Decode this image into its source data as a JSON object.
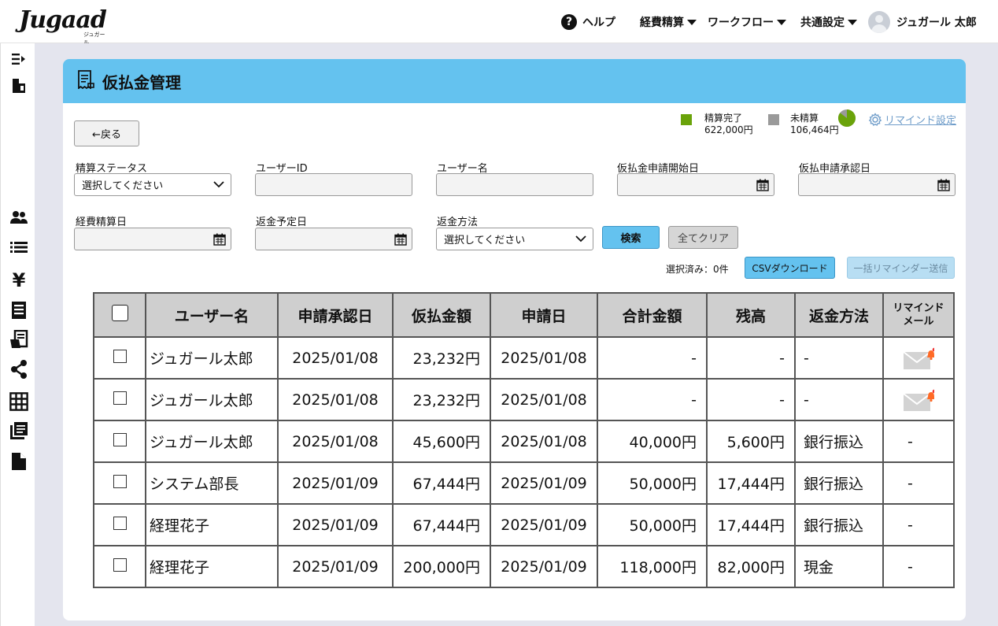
{
  "header": {
    "logo": "Jugaad",
    "logo_sub": "ジュガール",
    "help": "ヘルプ",
    "nav": [
      "経費精算",
      "ワークフロー",
      "共通設定"
    ],
    "user_name": "ジュガール 太郎"
  },
  "sidebar": {
    "icons": [
      "collapse-menu-icon",
      "building-icon",
      "users-icon",
      "list-icon",
      "yen-icon",
      "ledger-icon",
      "report-icon",
      "share-icon",
      "grid-icon",
      "books-icon",
      "document-icon"
    ]
  },
  "page": {
    "title": "仮払金管理",
    "back_label": "←戻る",
    "legend": {
      "done_label": "精算完了",
      "done_amount": "622,000円",
      "pending_label": "未精算",
      "pending_amount": "106,464円",
      "done_color": "#6aa30a",
      "pending_color": "#9a9a9a",
      "done_fraction": 0.854
    },
    "remind_settings": "リマインド設定"
  },
  "filters": {
    "status_label": "精算ステータス",
    "status_value": "選択してください",
    "user_id_label": "ユーザーID",
    "user_id_value": "",
    "user_name_label": "ユーザー名",
    "user_name_value": "",
    "apply_start_label": "仮払金申請開始日",
    "approve_date_label": "仮払申請承認日",
    "expense_date_label": "経費精算日",
    "refund_date_label": "返金予定日",
    "refund_method_label": "返金方法",
    "refund_method_value": "選択してください",
    "search_label": "検索",
    "clear_label": "全てクリア"
  },
  "actions": {
    "selected_count": "選択済み：0件",
    "csv_label": "CSVダウンロード",
    "bulk_label": "一括リマインダー送信"
  },
  "table": {
    "headers": [
      "ユーザー名",
      "申請承認日",
      "仮払金額",
      "申請日",
      "合計金額",
      "残高",
      "返金方法",
      "リマインド メール"
    ],
    "rows": [
      {
        "name": "ジュガール太郎",
        "approved": "2025/01/08",
        "advance": "23,232円",
        "applied": "2025/01/08",
        "total": "-",
        "balance": "-",
        "method": "-",
        "remind": "mail"
      },
      {
        "name": "ジュガール太郎",
        "approved": "2025/01/08",
        "advance": "23,232円",
        "applied": "2025/01/08",
        "total": "-",
        "balance": "-",
        "method": "-",
        "remind": "mail"
      },
      {
        "name": "ジュガール太郎",
        "approved": "2025/01/08",
        "advance": "45,600円",
        "applied": "2025/01/08",
        "total": "40,000円",
        "balance": "5,600円",
        "method": "銀行振込",
        "remind": "-"
      },
      {
        "name": "システム部長",
        "approved": "2025/01/09",
        "advance": "67,444円",
        "applied": "2025/01/09",
        "total": "50,000円",
        "balance": "17,444円",
        "method": "銀行振込",
        "remind": "-"
      },
      {
        "name": "経理花子",
        "approved": "2025/01/09",
        "advance": "67,444円",
        "applied": "2025/01/09",
        "total": "50,000円",
        "balance": "17,444円",
        "method": "銀行振込",
        "remind": "-"
      },
      {
        "name": "経理花子",
        "approved": "2025/01/09",
        "advance": "200,000円",
        "applied": "2025/01/09",
        "total": "118,000円",
        "balance": "82,000円",
        "method": "現金",
        "remind": "-"
      }
    ]
  }
}
